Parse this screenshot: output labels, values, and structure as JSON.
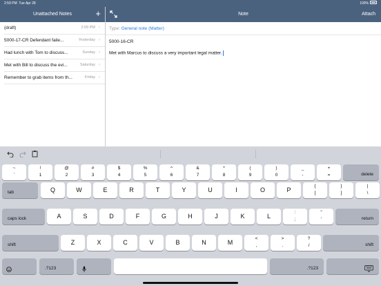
{
  "status": {
    "time": "2:59 PM",
    "date": "Tue Apr 28",
    "battery": "100%"
  },
  "list_header": {
    "title": "Unattached Notes",
    "add": "+"
  },
  "notes": [
    {
      "title": "(draft)",
      "date": "2:09 PM"
    },
    {
      "title": "5000-17-CR  Defendant faile...",
      "date": "Yesterday"
    },
    {
      "title": "Had lunch with Tom to discuss...",
      "date": "Sunday"
    },
    {
      "title": "Met with Bill to discuss the evi...",
      "date": "Saturday"
    },
    {
      "title": "Remember to grab items from th...",
      "date": "Friday"
    }
  ],
  "note_header": {
    "title": "Note",
    "attach": "Attach"
  },
  "note": {
    "type_label": "Type:",
    "type_value": "General note (Matter)",
    "reference": "5000-16-CR",
    "body": "Met with Marcus to discuss a very important legal matter."
  },
  "keyboard": {
    "number_row": [
      {
        "s": "~",
        "m": "`"
      },
      {
        "s": "!",
        "m": "1"
      },
      {
        "s": "@",
        "m": "2"
      },
      {
        "s": "#",
        "m": "3"
      },
      {
        "s": "$",
        "m": "4"
      },
      {
        "s": "%",
        "m": "5"
      },
      {
        "s": "^",
        "m": "6"
      },
      {
        "s": "&",
        "m": "7"
      },
      {
        "s": "*",
        "m": "8"
      },
      {
        "s": "(",
        "m": "9"
      },
      {
        "s": ")",
        "m": "0"
      },
      {
        "s": "_",
        "m": "-"
      },
      {
        "s": "+",
        "m": "="
      }
    ],
    "delete": "delete",
    "tab": "tab",
    "row_q": [
      "Q",
      "W",
      "E",
      "R",
      "T",
      "Y",
      "U",
      "I",
      "O",
      "P"
    ],
    "bracket_keys": [
      {
        "s": "{",
        "m": "["
      },
      {
        "s": "}",
        "m": "]"
      },
      {
        "s": "|",
        "m": "\\"
      }
    ],
    "caps_lock": "caps lock",
    "row_a": [
      "A",
      "S",
      "D",
      "F",
      "G",
      "H",
      "J",
      "K",
      "L"
    ],
    "punct_keys": [
      {
        "s": ":",
        "m": ";"
      },
      {
        "s": "\"",
        "m": "'"
      }
    ],
    "return": "return",
    "shift": "shift",
    "row_z": [
      "Z",
      "X",
      "C",
      "V",
      "B",
      "N",
      "M"
    ],
    "angle_keys": [
      {
        "s": "<",
        "m": ","
      },
      {
        "s": ">",
        "m": "."
      },
      {
        "s": "?",
        "m": "/"
      }
    ],
    "numbers_key": ".?123",
    "icons": {
      "undo": "undo-icon",
      "redo": "redo-icon",
      "paste": "paste-icon",
      "emoji": "emoji-icon",
      "mic": "microphone-icon",
      "dismiss": "keyboard-dismiss-icon",
      "expand": "expand-icon"
    }
  }
}
